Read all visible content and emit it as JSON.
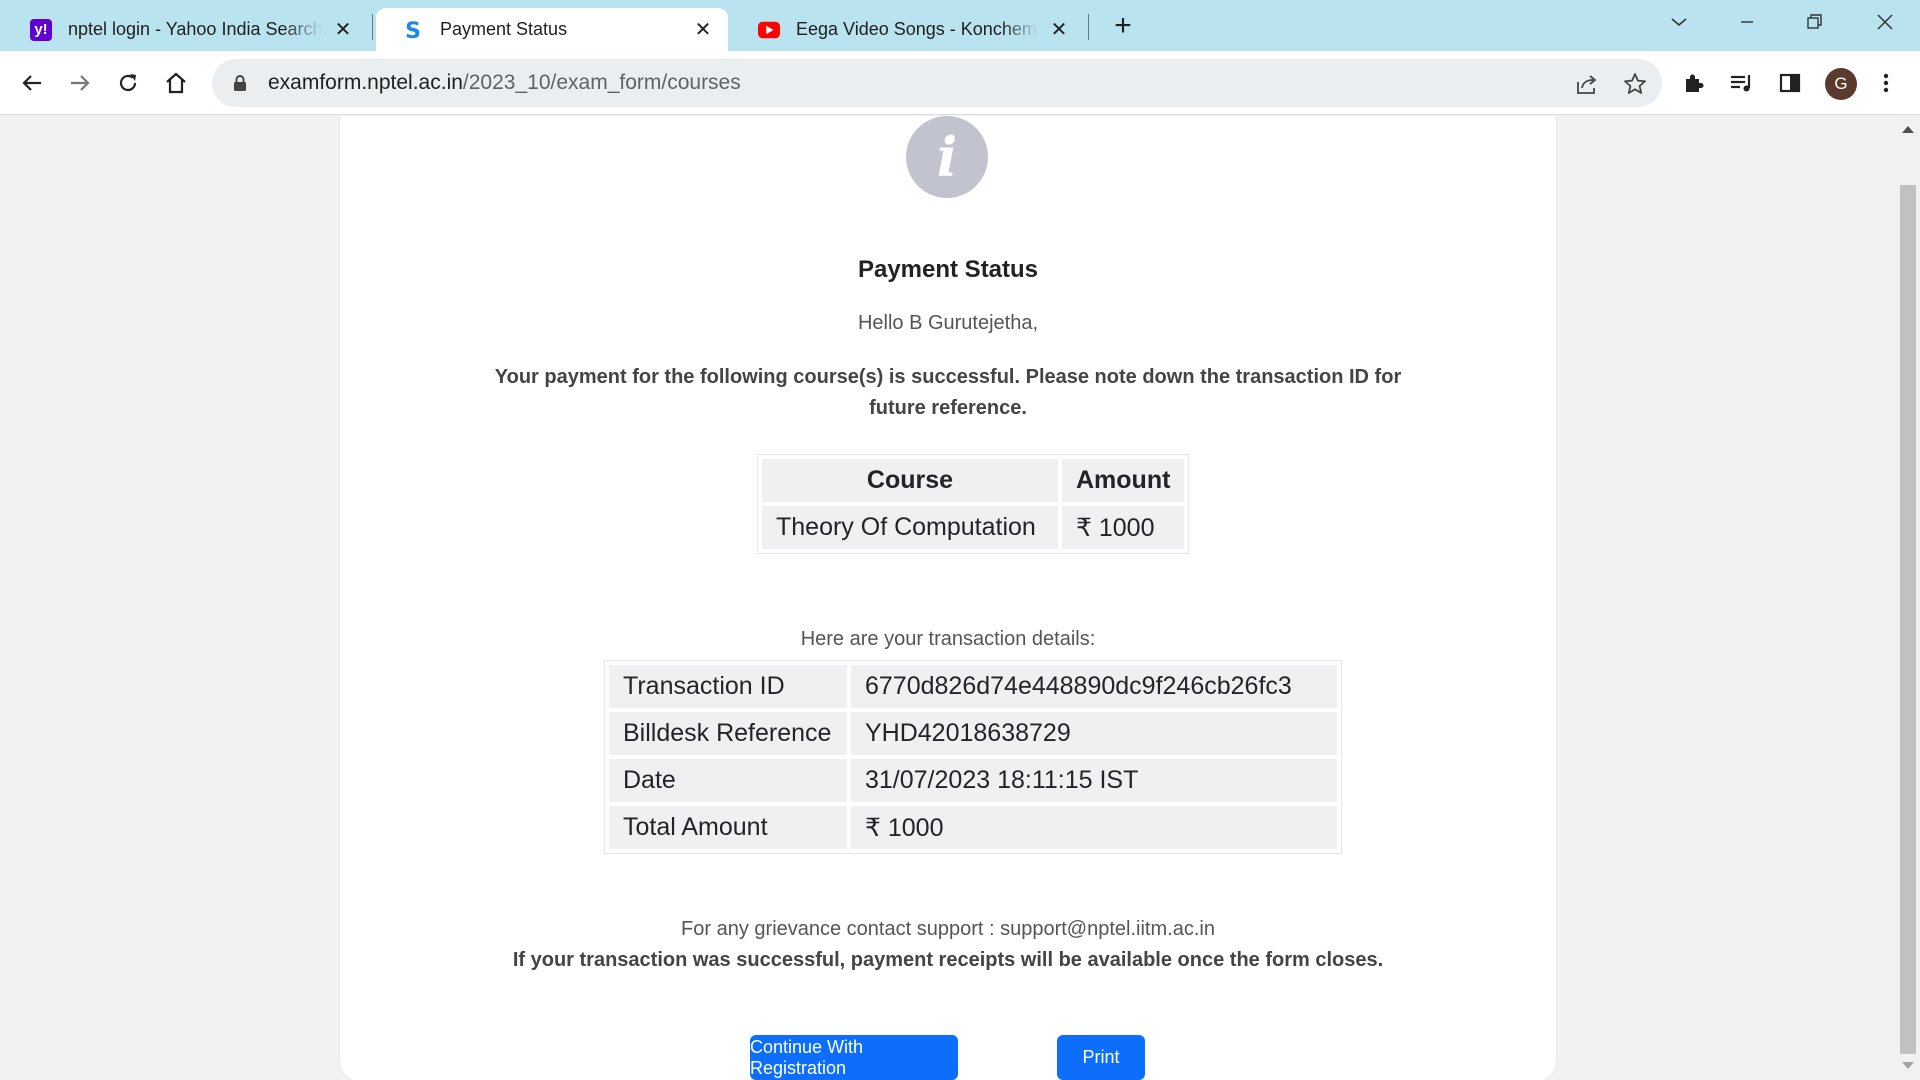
{
  "browser": {
    "tabs": [
      {
        "title": "nptel login - Yahoo India Search Results",
        "favicon": "yahoo-icon",
        "active": false
      },
      {
        "title": "Payment Status",
        "favicon": "swayam-icon",
        "active": true
      },
      {
        "title": "Eega Video Songs - Konchem Konchem",
        "favicon": "youtube-icon",
        "active": false
      }
    ],
    "new_tab_symbol": "+",
    "url_host": "examform.nptel.ac.in",
    "url_path": "/2023_10/exam_form/courses",
    "profile_initial": "G"
  },
  "page": {
    "title": "Payment Status",
    "greeting": "Hello B Gurutejetha,",
    "message": "Your payment for the following course(s) is successful. Please note down the transaction ID for future reference.",
    "course_table": {
      "headers": [
        "Course",
        "Amount"
      ],
      "rows": [
        [
          "Theory Of Computation",
          "₹ 1000"
        ]
      ]
    },
    "details_label": "Here are your transaction details:",
    "transaction": {
      "rows": [
        [
          "Transaction ID",
          "6770d826d74e448890dc9f246cb26fc3"
        ],
        [
          "Billdesk Reference",
          "YHD42018638729"
        ],
        [
          "Date",
          "31/07/2023 18:11:15 IST"
        ],
        [
          "Total Amount",
          "₹ 1000"
        ]
      ]
    },
    "support_text": "For any grievance contact support : support@nptel.iitm.ac.in",
    "receipt_text": "If your transaction was successful, payment receipts will be available once the form closes.",
    "buttons": {
      "continue": "Continue With Registration",
      "print": "Print"
    },
    "info_icon_glyph": "i"
  },
  "colors": {
    "tabstrip": "#b9e3ef",
    "primary_button": "#0d6efd",
    "info_circle": "#c1c4cf"
  }
}
